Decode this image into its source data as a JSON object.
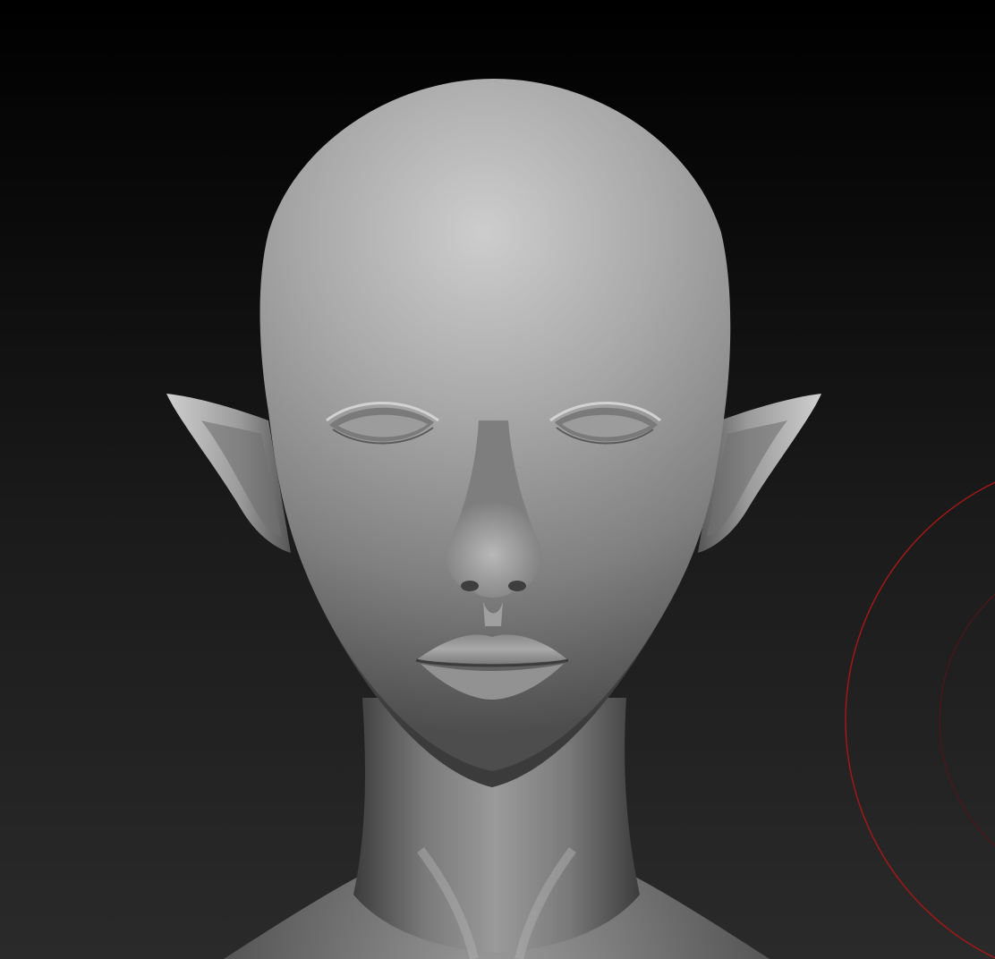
{
  "viewport": {
    "background_top": "#000000",
    "background_bottom": "#2a2a2a",
    "model": "elf-head-bust",
    "material": "matcap-gray",
    "skin_light": "#c9c9c9",
    "skin_mid": "#8e8e8e",
    "skin_dark": "#3a3a3a",
    "brush_cursor_color": "#a01818"
  }
}
